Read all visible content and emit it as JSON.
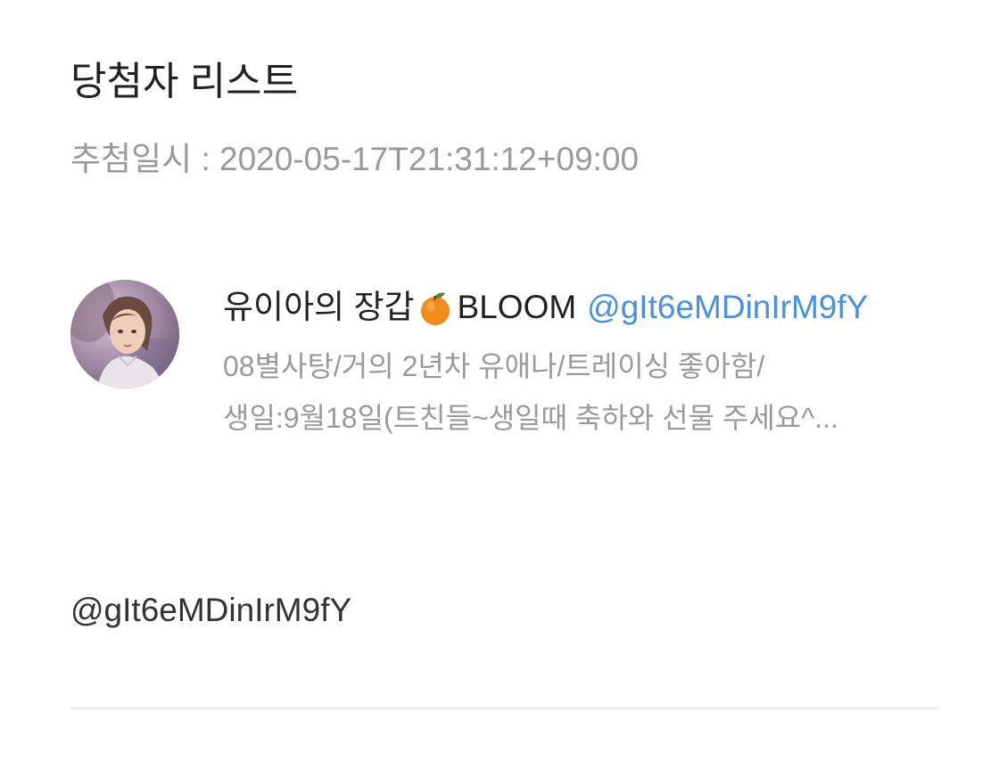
{
  "header": {
    "title": "당첨자 리스트",
    "draw_time": "추첨일시 : 2020-05-17T21:31:12+09:00"
  },
  "winner": {
    "display_name": "유이아의 장갑",
    "name_suffix": "BLOOM",
    "name_icon": "orange-emoji-icon",
    "handle": "@gIt6eMDinIrM9fY",
    "bio_lines": [
      "08별사탕/거의 2년차 유애나/트레이싱 좋아함/",
      "생일:9월18일(트친들~생일때 축하와 선물 주세요^..."
    ],
    "id_text": "@gIt6eMDinIrM9fY"
  },
  "colors": {
    "handle": "#4a90e2",
    "muted": "#9a9a9a",
    "text": "#222222",
    "divider": "#e6e6e6"
  }
}
